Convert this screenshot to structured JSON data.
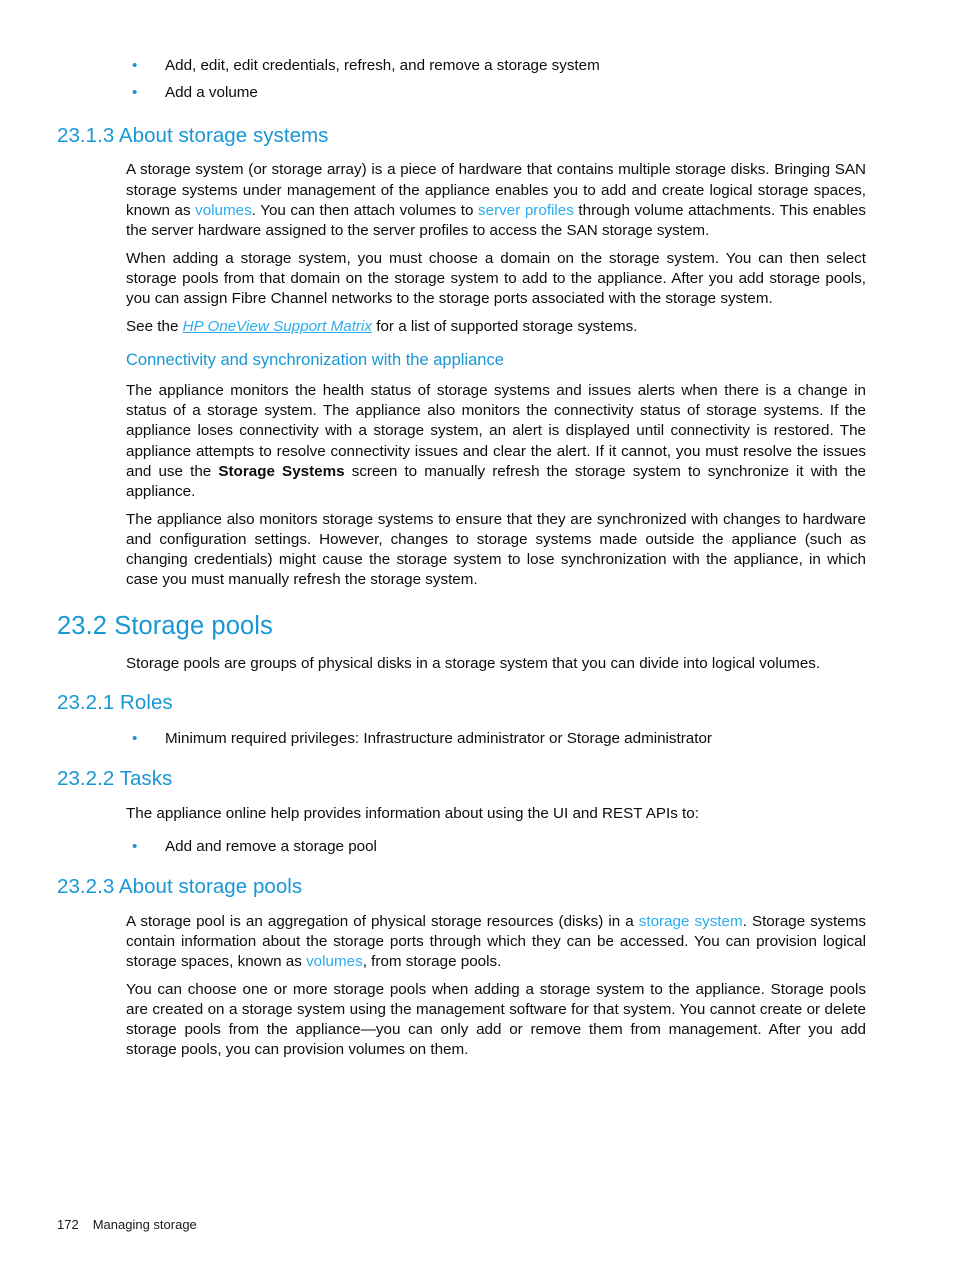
{
  "document": {
    "page_number": "172",
    "chapter_name": "Managing storage"
  },
  "colors": {
    "heading": "#1897d4",
    "link": "#2badee",
    "bullet": "#1897d4",
    "body_text": "#0d0d0d",
    "page_background": "#ffffff"
  },
  "top_list": {
    "items": [
      "Add, edit, edit credentials, refresh, and remove a storage system",
      "Add a volume"
    ],
    "bullet_glyph": "•"
  },
  "section_23_1_3": {
    "heading": "23.1.3 About storage systems",
    "p1": {
      "part1": "A storage system (or storage array) is a piece of hardware that contains multiple storage disks. Bringing SAN storage systems under management of the appliance enables you to add and create logical storage spaces, known as ",
      "link1": "volumes",
      "part2": ". You can then attach volumes to ",
      "link2": "server profiles",
      "part3": " through volume attachments. This enables the server hardware assigned to the server profiles to access the SAN storage system."
    },
    "p2": "When adding a storage system, you must choose a domain on the storage system. You can then select storage pools from that domain on the storage system to add to the appliance. After you add storage pools, you can assign Fibre Channel networks to the storage ports associated with the storage system.",
    "p3": {
      "part1": "See the ",
      "link1": "HP OneView Support Matrix",
      "part2": " for a list of supported storage systems."
    },
    "subheading": "Connectivity and synchronization with the appliance",
    "p4": {
      "part1": "The appliance monitors the health status of storage systems and issues alerts when there is a change in status of a storage system. The appliance also monitors the connectivity status of storage systems. If the appliance loses connectivity with a storage system, an alert is displayed until connectivity is restored. The appliance attempts to resolve connectivity issues and clear the alert. If it cannot, you must resolve the issues and use the ",
      "bold1": "Storage Systems",
      "part2": " screen to manually refresh the storage system to synchronize it with the appliance."
    },
    "p5": "The appliance also monitors storage systems to ensure that they are synchronized with changes to hardware and configuration settings. However, changes to storage systems made outside the appliance (such as changing credentials) might cause the storage system to lose synchronization with the appliance, in which case you must manually refresh the storage system."
  },
  "section_23_2": {
    "heading": "23.2 Storage pools",
    "intro": "Storage pools are groups of physical disks in a storage system that you can divide into logical volumes."
  },
  "section_23_2_1": {
    "heading": "23.2.1 Roles",
    "items": [
      "Minimum required privileges: Infrastructure administrator or Storage administrator"
    ]
  },
  "section_23_2_2": {
    "heading": "23.2.2 Tasks",
    "intro": "The appliance online help provides information about using the UI and REST APIs to:",
    "items": [
      "Add and remove a storage pool"
    ]
  },
  "section_23_2_3": {
    "heading": "23.2.3 About storage pools",
    "p1": {
      "part1": "A storage pool is an aggregation of physical storage resources (disks) in a ",
      "link1": "storage system",
      "part2": ". Storage systems contain information about the storage ports through which they can be accessed. You can provision logical storage spaces, known as ",
      "link2": "volumes",
      "part3": ", from storage pools."
    },
    "p2": "You can choose one or more storage pools when adding a storage system to the appliance. Storage pools are created on a storage system using the management software for that system. You cannot create or delete storage pools from the appliance—you can only add or remove them from management. After you add storage pools, you can provision volumes on them."
  }
}
